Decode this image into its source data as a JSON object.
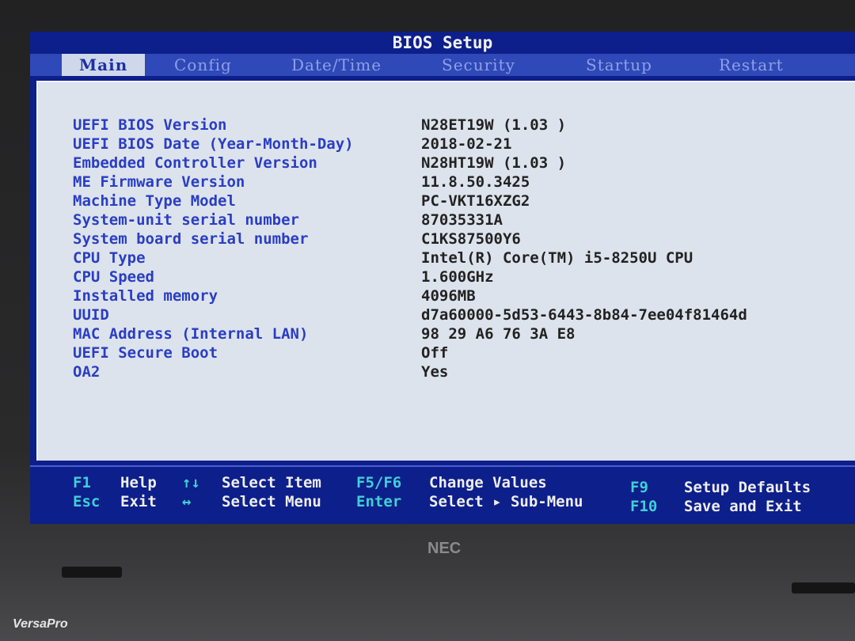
{
  "window": {
    "title": "BIOS Setup"
  },
  "tabs": [
    {
      "label": "Main"
    },
    {
      "label": "Config"
    },
    {
      "label": "Date/Time"
    },
    {
      "label": "Security"
    },
    {
      "label": "Startup"
    },
    {
      "label": "Restart"
    }
  ],
  "info": [
    {
      "label": "UEFI BIOS Version",
      "value": "N28ET19W (1.03 )"
    },
    {
      "label": "UEFI BIOS Date (Year-Month-Day)",
      "value": "2018-02-21"
    },
    {
      "label": "Embedded Controller Version",
      "value": "N28HT19W (1.03 )"
    },
    {
      "label": "ME Firmware Version",
      "value": "11.8.50.3425"
    },
    {
      "label": "Machine Type Model",
      "value": "PC-VKT16XZG2"
    },
    {
      "label": "System-unit serial number",
      "value": "87035331A"
    },
    {
      "label": "System board serial number",
      "value": "C1KS87500Y6"
    },
    {
      "label": "CPU Type",
      "value": "Intel(R) Core(TM) i5-8250U CPU"
    },
    {
      "label": "CPU Speed",
      "value": "1.600GHz"
    },
    {
      "label": "Installed memory",
      "value": "4096MB"
    },
    {
      "label": "UUID",
      "value": "d7a60000-5d53-6443-8b84-7ee04f81464d"
    },
    {
      "label": "MAC Address (Internal LAN)",
      "value": "98 29 A6 76 3A E8"
    },
    {
      "label": "UEFI Secure Boot",
      "value": "Off"
    },
    {
      "label": "OA2",
      "value": "Yes"
    }
  ],
  "footer": {
    "f1_key": "F1",
    "f1_desc": "Help",
    "esc_key": "Esc",
    "esc_desc": "Exit",
    "updown_key": "↑↓",
    "updown_desc": "Select Item",
    "leftright_key": "↔",
    "leftright_desc": "Select Menu",
    "f5f6_key": "F5/F6",
    "f5f6_desc": "Change Values",
    "enter_key": "Enter",
    "enter_desc": "Select ▸ Sub-Menu",
    "f9_key": "F9",
    "f9_desc": "Setup Defaults",
    "f10_key": "F10",
    "f10_desc": "Save and Exit"
  },
  "hardware": {
    "brand": "NEC",
    "model": "VersaPro"
  },
  "colors": {
    "screen_bg": "#0d1f8a",
    "panel_bg": "#dde3ec",
    "label_text": "#2a3ec2",
    "value_text": "#222222",
    "footer_key": "#3fd0d6"
  }
}
